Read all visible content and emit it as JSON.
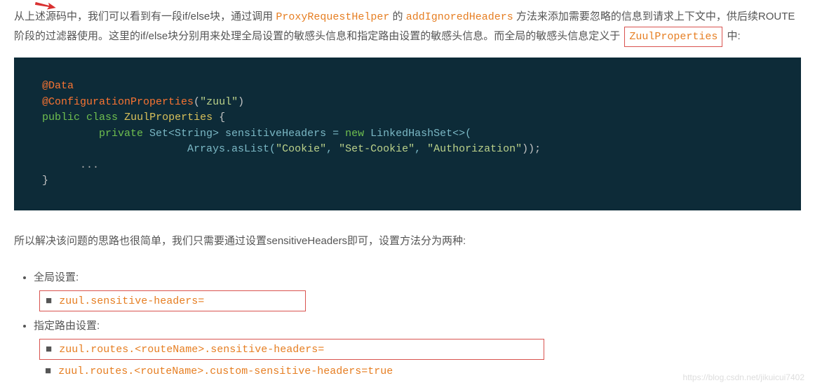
{
  "para1": {
    "t1": "从上述源码中，我们可以看到有一段if/else块，通过调用 ",
    "h1": "ProxyRequestHelper",
    "t2": " 的 ",
    "h2": "addIgnoredHeaders",
    "t3": " 方法来添加需要忽略的信息到请求上下文中，供后续ROUTE阶段的过滤器使用。这里的if/else块分别用来处理全局设置的敏感头信息和指定路由设置的敏感头信息。而全局的敏感头信息定义于 ",
    "h3": "ZuulProperties",
    "t4": " 中:"
  },
  "code": {
    "l1a": "@Data",
    "l2a": "@ConfigurationProperties",
    "l2b": "(",
    "l2c": "\"zuul\"",
    "l2d": ")",
    "l3a": "public",
    "l3b": " ",
    "l3c": "class",
    "l3d": " ",
    "l3e": "ZuulProperties",
    "l3f": " {",
    "l4a": "         ",
    "l4b": "private",
    "l4c": " Set<String> sensitiveHeaders = ",
    "l4d": "new",
    "l4e": " LinkedHashSet<>(",
    "l5a": "                       Arrays.asList(",
    "l5b": "\"Cookie\"",
    "l5c": ", ",
    "l5d": "\"Set-Cookie\"",
    "l5e": ", ",
    "l5f": "\"Authorization\"",
    "l5g": "));",
    "l6": "      ...",
    "l7": "}"
  },
  "para2": "所以解决该问题的思路也很简单，我们只需要通过设置sensitiveHeaders即可，设置方法分为两种:",
  "list": {
    "item1_label": "全局设置:",
    "item1_code": "zuul.sensitive-headers=",
    "item2_label": "指定路由设置:",
    "item2_code1": "zuul.routes.<routeName>.sensitive-headers=",
    "item2_code2": "zuul.routes.<routeName>.custom-sensitive-headers=true",
    "bullet": "■"
  },
  "watermark": "https://blog.csdn.net/jikuicui7402"
}
